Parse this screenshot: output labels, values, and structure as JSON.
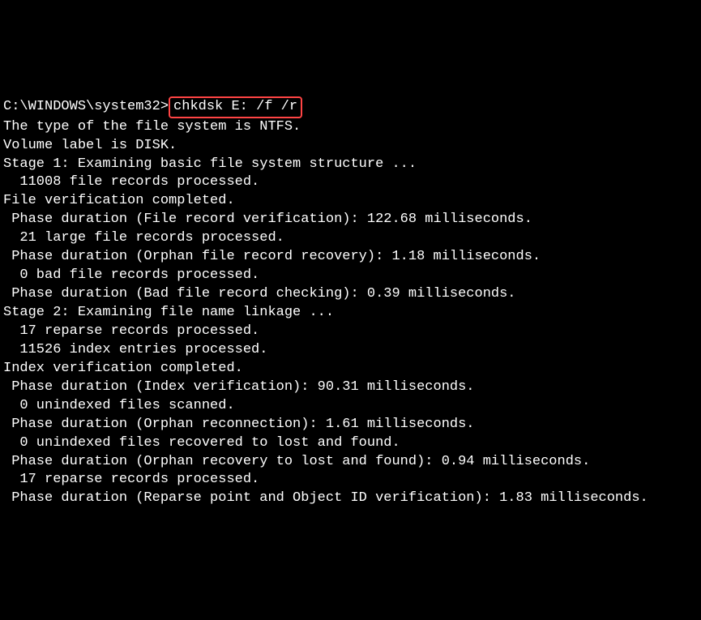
{
  "prompt": {
    "path": "C:\\WINDOWS\\system32>",
    "command": "chkdsk E: /f /r"
  },
  "lines": [
    "The type of the file system is NTFS.",
    "Volume label is DISK.",
    "",
    "Stage 1: Examining basic file system structure ...",
    "  11008 file records processed.",
    "File verification completed.",
    " Phase duration (File record verification): 122.68 milliseconds.",
    "  21 large file records processed.",
    " Phase duration (Orphan file record recovery): 1.18 milliseconds.",
    "  0 bad file records processed.",
    " Phase duration (Bad file record checking): 0.39 milliseconds.",
    "",
    "Stage 2: Examining file name linkage ...",
    "  17 reparse records processed.",
    "  11526 index entries processed.",
    "Index verification completed.",
    " Phase duration (Index verification): 90.31 milliseconds.",
    "  0 unindexed files scanned.",
    " Phase duration (Orphan reconnection): 1.61 milliseconds.",
    "  0 unindexed files recovered to lost and found.",
    " Phase duration (Orphan recovery to lost and found): 0.94 milliseconds.",
    "  17 reparse records processed.",
    " Phase duration (Reparse point and Object ID verification): 1.83 milliseconds."
  ]
}
